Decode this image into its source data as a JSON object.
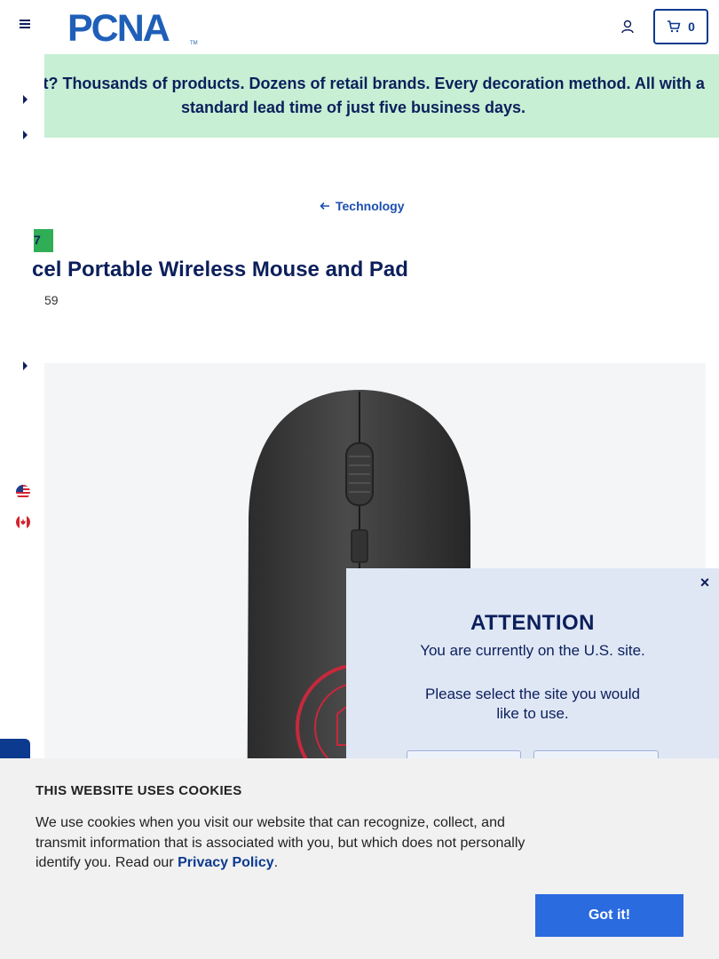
{
  "header": {
    "logo_text": "PCNA",
    "logo_tm": "TM",
    "cart_count": "0",
    "brand_color": "#1f5fb8"
  },
  "promo": {
    "text": "y Wait? Thousands of products. Dozens of retail brands. Every decoration method. All with a standard lead time of just five business days.",
    "background": "#c6efd4"
  },
  "breadcrumb": {
    "back_label": "Technology"
  },
  "product": {
    "badge": "7",
    "title": "cel Portable Wireless Mouse and Pad",
    "sku": "59"
  },
  "image": {
    "description_icon": "wireless-mouse-image"
  },
  "modal": {
    "close_label": "×",
    "title": "ATTENTION",
    "line1": "You are currently on the U.S. site.",
    "line2": "Please select the site you would",
    "line3": "like to use."
  },
  "cookie": {
    "title": "THIS WEBSITE USES COOKIES",
    "body": "We use cookies when you visit our website that can recognize, collect, and transmit information that is associated with you, but which does not personally identify you. Read our ",
    "link": "Privacy Policy",
    "end": ".",
    "button": "Got it!"
  }
}
